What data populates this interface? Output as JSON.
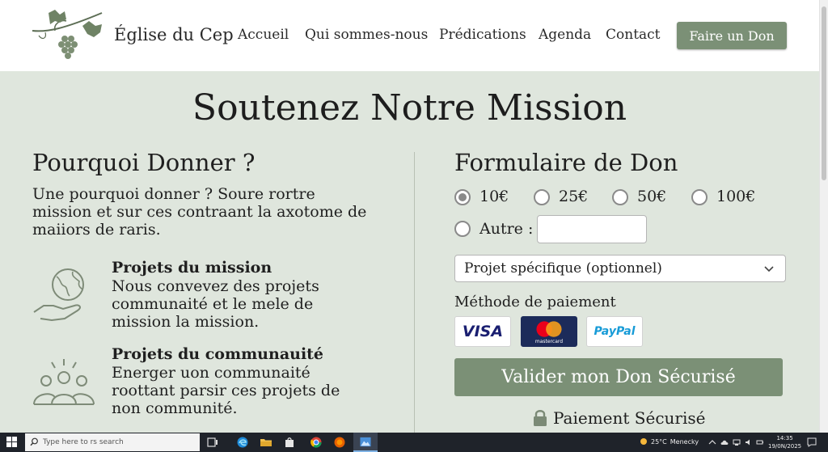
{
  "header": {
    "brand": "Église du Cep",
    "nav": [
      "Accueil",
      "Qui sommes-nous",
      "Prédications",
      "Agenda",
      "Contact"
    ],
    "donate_label": "Faire un Don"
  },
  "main": {
    "title": "Soutenez Notre Mission",
    "left": {
      "heading": "Pourquoi Donner ?",
      "intro": "Une pourquoi donner ? Soure rortre mission et sur ces contraant la axotome de maiiors de raris.",
      "features": [
        {
          "title": "Projets du mission",
          "desc": "Nous convevez des projets communaité et le mele de mission la mission."
        },
        {
          "title": "Projets du communauité",
          "desc": "Energer uon communaité roottant parsir ces projets de non communité."
        }
      ]
    },
    "right": {
      "heading": "Formulaire de Don",
      "amounts": [
        "10€",
        "25€",
        "50€",
        "100€"
      ],
      "selected_amount": "10€",
      "other_label": "Autre :",
      "other_value": "",
      "project_select": "Projet spécifique (optionnel)",
      "payment_label": "Méthode de paiement",
      "payment_methods": [
        "VISA",
        "mastercard",
        "PayPal"
      ],
      "validate_label": "Valider mon Don Sécurisé",
      "secure_label": "Paiement Sécurisé"
    }
  },
  "colors": {
    "accent": "#7b9076",
    "background": "#dfe6dd",
    "visa_blue": "#1a1f71",
    "paypal_dark": "#253b80",
    "paypal_light": "#179bd7"
  },
  "taskbar": {
    "search_placeholder": "Type here to rs search",
    "weather": "25°C",
    "weather_place": "Menecky",
    "time": "14:35",
    "date": "19/0N/2025"
  }
}
